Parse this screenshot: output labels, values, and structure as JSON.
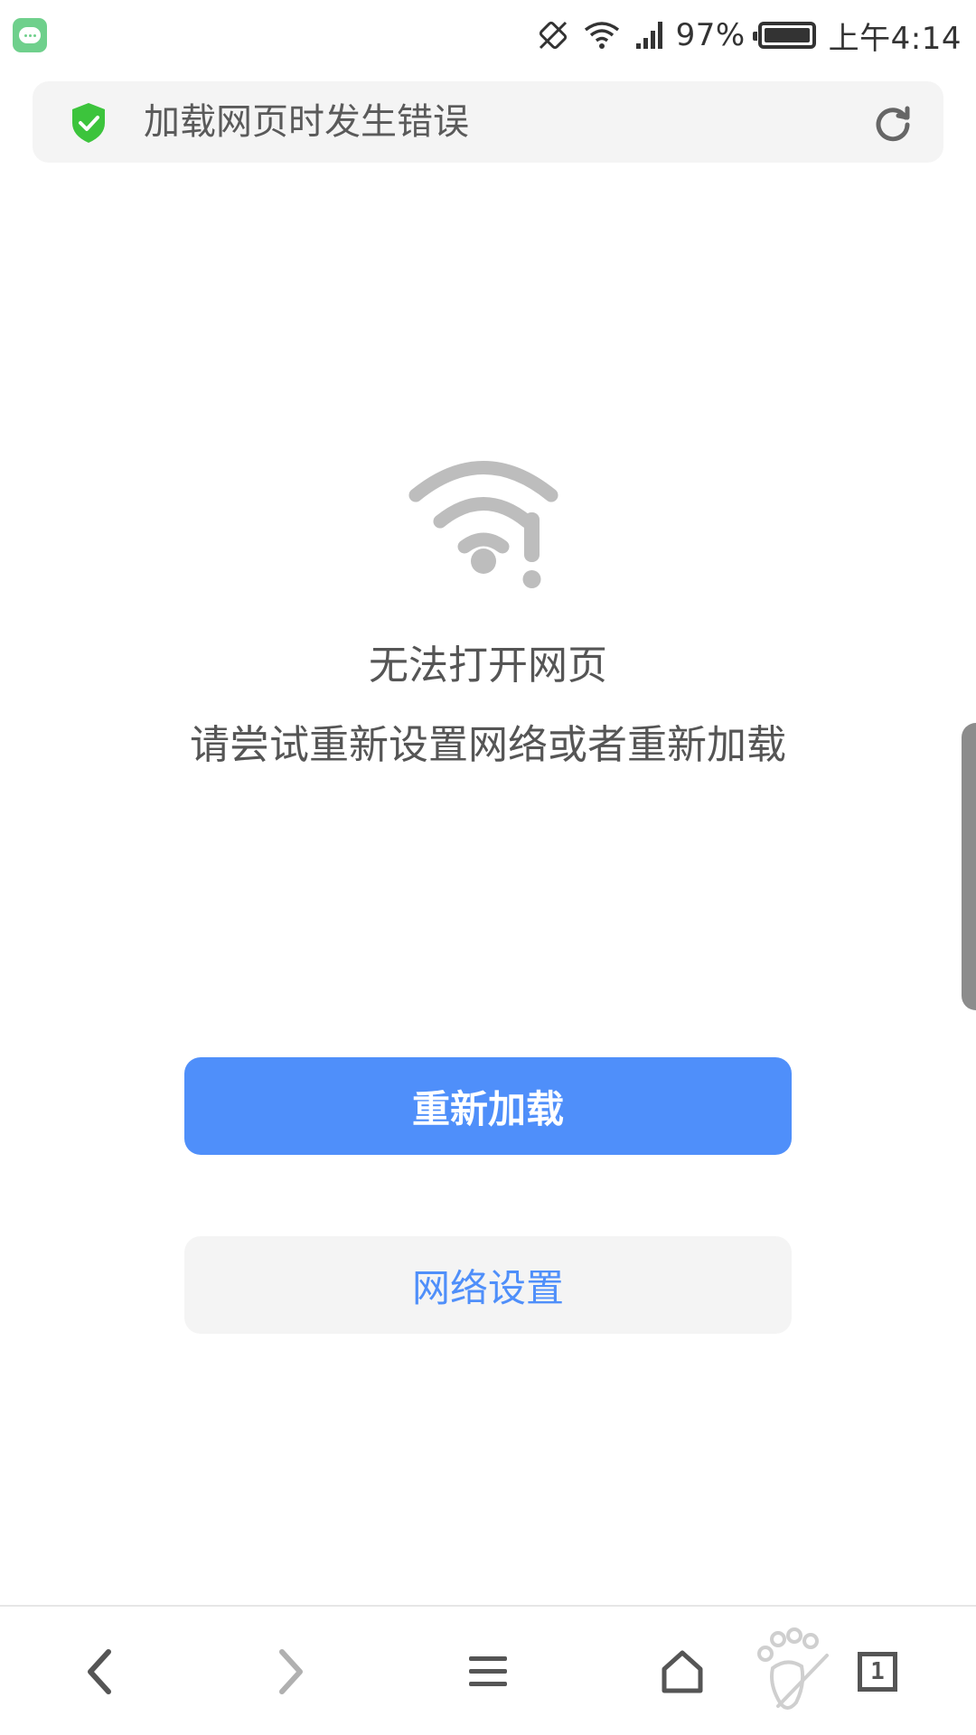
{
  "status_bar": {
    "battery": "97%",
    "time": "上午4:14",
    "icons": [
      "message-icon",
      "rotate-icon",
      "wifi-icon",
      "signal-icon",
      "battery-icon"
    ]
  },
  "address_bar": {
    "text": "加载网页时发生错误",
    "security_color": "#3cc43c"
  },
  "error": {
    "title": "无法打开网页",
    "subtitle": "请尝试重新设置网络或者重新加载",
    "icon": "wifi-error-icon"
  },
  "buttons": {
    "reload": "重新加载",
    "network_settings": "网络设置"
  },
  "bottom_nav": {
    "tab_count": "1",
    "items": [
      "back-icon",
      "forward-icon",
      "menu-icon",
      "home-icon",
      "paw-icon",
      "tabs-icon"
    ]
  },
  "colors": {
    "accent": "#4f8ffa",
    "icon_gray": "#bdbdbd"
  }
}
